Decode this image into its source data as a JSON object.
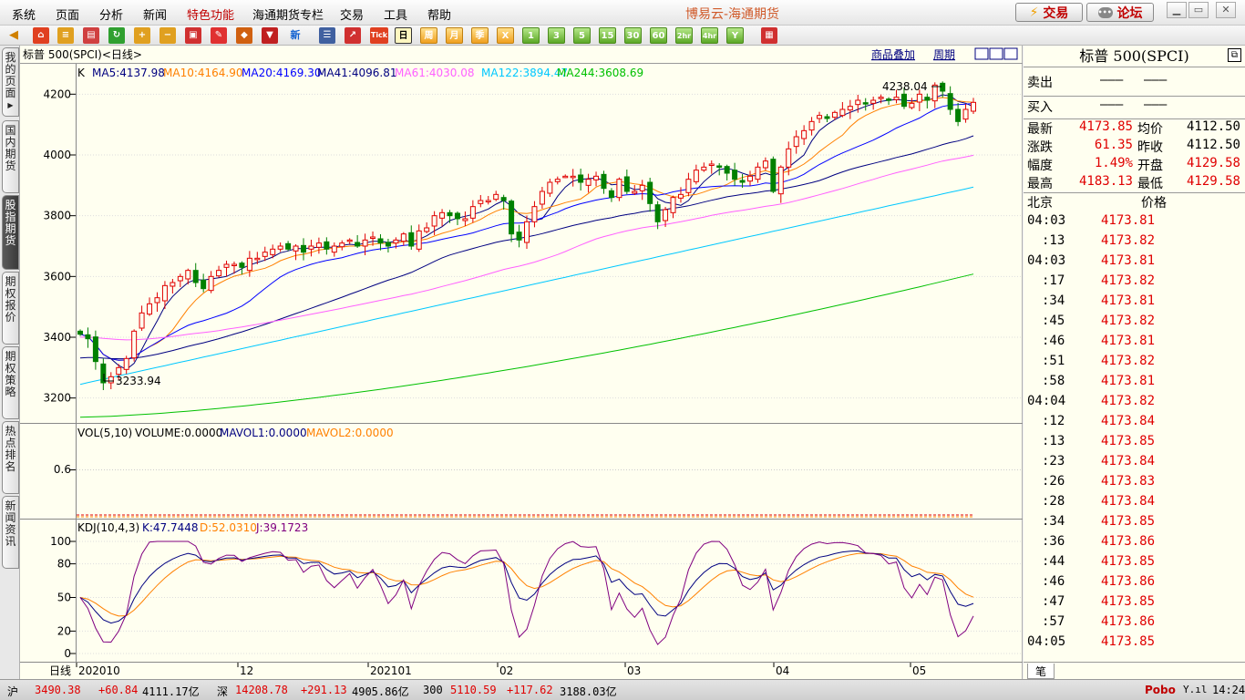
{
  "menu": {
    "items": [
      "系统",
      "页面",
      "分析",
      "新闻",
      "特色功能",
      "海通期货专栏",
      "交易",
      "工具",
      "帮助"
    ],
    "highlight": "特色功能",
    "app_title": "博易云-海通期货",
    "trade_btn": "交易",
    "forum_btn": "论坛"
  },
  "toolbar": {
    "periods": [
      "日",
      "周",
      "月",
      "季",
      "X",
      "1",
      "3",
      "5",
      "15",
      "30",
      "60",
      "2hr",
      "4hr",
      "Y"
    ],
    "selected": "日",
    "tick": "Tick",
    "new": "新"
  },
  "sidetabs": [
    "我的页面",
    "国内期货",
    "股指期货",
    "期权报价",
    "期权策略",
    "热点排名",
    "新闻资讯"
  ],
  "active_sidetab": "股指期货",
  "chart": {
    "symbol_line": "标普 500(SPCI)<日线>",
    "overlay_btn": "商品叠加",
    "period_btn": "周期",
    "k_label": "K",
    "ma": [
      {
        "t": "MA5:4137.98",
        "c": "#000080"
      },
      {
        "t": "MA10:4164.90",
        "c": "#ff8000"
      },
      {
        "t": "MA20:4169.30",
        "c": "#0000ff"
      },
      {
        "t": "MA41:4096.81",
        "c": "#000080"
      },
      {
        "t": "MA61:4030.08",
        "c": "#ff60ff"
      },
      {
        "t": "MA122:3894.47",
        "c": "#00c8ff"
      },
      {
        "t": "MA244:3608.69",
        "c": "#00c000"
      }
    ],
    "high_label": "4238.04",
    "low_label": "3233.94",
    "price_ticks": [
      "4200",
      "4000",
      "3800",
      "3600",
      "3400",
      "3200"
    ],
    "vol_label": "VOL(5,10)",
    "vol_value": "VOLUME:0.0000",
    "mavol1": "MAVOL1:0.0000",
    "mavol2": "MAVOL2:0.0000",
    "vol_tick": "0.6",
    "kdj_label": "KDJ(10,4,3)",
    "kdj_k": "K:47.7448",
    "kdj_d": "D:52.0310",
    "kdj_j": "J:39.1723",
    "kdj_ticks": [
      "100",
      "80",
      "50",
      "20",
      "0"
    ],
    "x_axis_label": "日线",
    "date_ticks": [
      "202010",
      "12",
      "202101",
      "02",
      "03",
      "04",
      "05"
    ]
  },
  "chart_data": {
    "type": "candlestick",
    "title": "标普 500(SPCI)<日线>",
    "ylim": [
      3130,
      4270
    ],
    "high": 4238.04,
    "low": 3233.94,
    "closes": [
      3410,
      3395,
      3320,
      3250,
      3270,
      3300,
      3330,
      3420,
      3480,
      3510,
      3530,
      3570,
      3580,
      3600,
      3620,
      3580,
      3560,
      3600,
      3620,
      3640,
      3640,
      3630,
      3660,
      3660,
      3680,
      3690,
      3700,
      3690,
      3700,
      3680,
      3700,
      3710,
      3690,
      3700,
      3710,
      3720,
      3700,
      3720,
      3730,
      3710,
      3700,
      3720,
      3740,
      3700,
      3750,
      3760,
      3800,
      3810,
      3800,
      3790,
      3790,
      3830,
      3850,
      3850,
      3870,
      3850,
      3740,
      3720,
      3780,
      3830,
      3880,
      3910,
      3920,
      3930,
      3930,
      3910,
      3920,
      3930,
      3890,
      3860,
      3920,
      3880,
      3880,
      3900,
      3840,
      3780,
      3820,
      3860,
      3870,
      3920,
      3950,
      3960,
      3970,
      3960,
      3940,
      3920,
      3910,
      3930,
      3960,
      3980,
      3880,
      3960,
      4020,
      4060,
      4080,
      4110,
      4130,
      4120,
      4140,
      4150,
      4160,
      4180,
      4170,
      4180,
      4190,
      4180,
      4190,
      4160,
      4170,
      4200,
      4180,
      4230,
      4210,
      4150,
      4110,
      4150,
      4173
    ]
  },
  "quote": {
    "title": "标普 500(SPCI)",
    "sell": "卖出",
    "buy": "买入",
    "dash": "———",
    "rows": [
      [
        "最新",
        "4173.85",
        "均价",
        "4112.50"
      ],
      [
        "涨跌",
        "61.35",
        "昨收",
        "4112.50"
      ],
      [
        "幅度",
        "1.49%",
        "开盘",
        "4129.58"
      ],
      [
        "最高",
        "4183.13",
        "最低",
        "4129.58"
      ]
    ],
    "tick_hdr": [
      "北京",
      "价格"
    ],
    "ticks": [
      [
        "04:03",
        "4173.81"
      ],
      [
        ":13",
        "4173.82"
      ],
      [
        "04:03",
        "4173.81"
      ],
      [
        ":17",
        "4173.82"
      ],
      [
        ":34",
        "4173.81"
      ],
      [
        ":45",
        "4173.82"
      ],
      [
        ":46",
        "4173.81"
      ],
      [
        ":51",
        "4173.82"
      ],
      [
        ":58",
        "4173.81"
      ],
      [
        "04:04",
        "4173.82"
      ],
      [
        ":12",
        "4173.84"
      ],
      [
        ":13",
        "4173.85"
      ],
      [
        ":23",
        "4173.84"
      ],
      [
        ":26",
        "4173.83"
      ],
      [
        ":28",
        "4173.84"
      ],
      [
        ":34",
        "4173.85"
      ],
      [
        ":36",
        "4173.86"
      ],
      [
        ":44",
        "4173.85"
      ],
      [
        ":46",
        "4173.86"
      ],
      [
        ":47",
        "4173.85"
      ],
      [
        ":57",
        "4173.86"
      ],
      [
        "04:05",
        "4173.85"
      ]
    ],
    "bottom_tab": "笔"
  },
  "status": {
    "items": [
      [
        "沪",
        "3490.38",
        "+60.84",
        "4111.17亿"
      ],
      [
        "深",
        "14208.78",
        "+291.13",
        "4905.86亿"
      ],
      [
        "300",
        "5110.59",
        "+117.62",
        "3188.03亿"
      ]
    ],
    "brand": "Pobo",
    "time": "14:24"
  }
}
